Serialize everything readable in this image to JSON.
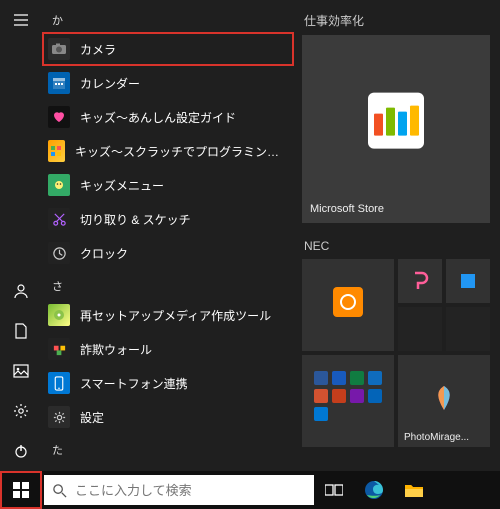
{
  "headers": {
    "ka": "か",
    "sa": "さ",
    "ta": "た"
  },
  "apps": {
    "camera": "カメラ",
    "calendar": "カレンダー",
    "kids_safe": "キッズ～あんしん設定ガイド",
    "kids_scratch": "キッズ～スクラッチでプログラミングをはじめよう",
    "kids_menu": "キッズメニュー",
    "snip": "切り取り & スケッチ",
    "clock": "クロック",
    "recovery": "再セットアップメディア作成ツール",
    "sagi": "詐欺ウォール",
    "phone": "スマートフォン連携",
    "settings": "設定"
  },
  "tiles": {
    "group1": "仕事効率化",
    "msstore": "Microsoft Store",
    "group2": "NEC",
    "photomirage": "PhotoMirage..."
  },
  "search": {
    "placeholder": "ここに入力して検索"
  }
}
